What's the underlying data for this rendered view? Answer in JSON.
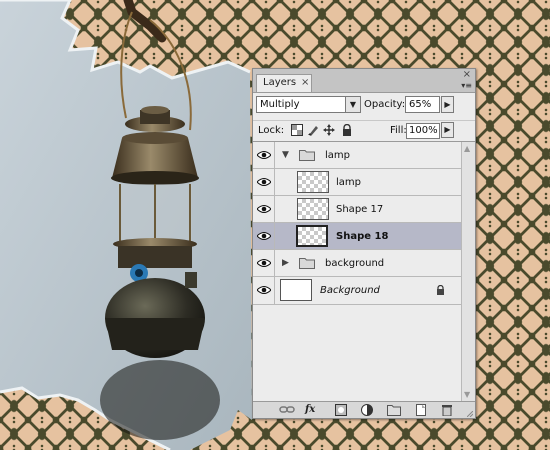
{
  "panel": {
    "tab_label": "Layers",
    "tab_close_glyph": "×",
    "close_glyph": "×",
    "menu_glyph": "▾≡"
  },
  "blend": {
    "mode": "Multiply",
    "arrow": "▼"
  },
  "opacity": {
    "label": "Opacity:",
    "value": "65%",
    "arrow": "▶"
  },
  "lock": {
    "label": "Lock:",
    "icons": [
      "lock-transparent-icon",
      "lock-paint-icon",
      "lock-move-icon",
      "lock-all-icon"
    ]
  },
  "fill": {
    "label": "Fill:",
    "value": "100%",
    "arrow": "▶"
  },
  "layers": [
    {
      "name": "lamp",
      "kind": "group",
      "expanded": true,
      "visible": true,
      "selected": false
    },
    {
      "name": "lamp",
      "kind": "layer",
      "indent": true,
      "visible": true,
      "selected": false
    },
    {
      "name": "Shape 17",
      "kind": "layer",
      "indent": true,
      "visible": true,
      "selected": false
    },
    {
      "name": "Shape 18",
      "kind": "layer",
      "indent": true,
      "visible": true,
      "selected": true
    },
    {
      "name": "background",
      "kind": "group",
      "expanded": false,
      "visible": true,
      "selected": false
    },
    {
      "name": "Background",
      "kind": "background",
      "visible": true,
      "selected": false,
      "locked": true
    }
  ],
  "group_toggle": {
    "expanded": "▼",
    "collapsed": "▶"
  },
  "scroll": {
    "up": "▲",
    "down": "▼"
  },
  "bottom_bar": {
    "link_icon": "link-layers-icon",
    "fx_label": "fx",
    "icons": [
      "layer-mask-icon",
      "adjustment-layer-icon",
      "new-group-icon",
      "new-layer-icon",
      "trash-icon"
    ]
  },
  "colors": {
    "selected_row": "#b6b8c8",
    "damask_dark": "#4a4a2c",
    "damask_light": "#e6c2a0",
    "wall": "#b8c4cc"
  }
}
